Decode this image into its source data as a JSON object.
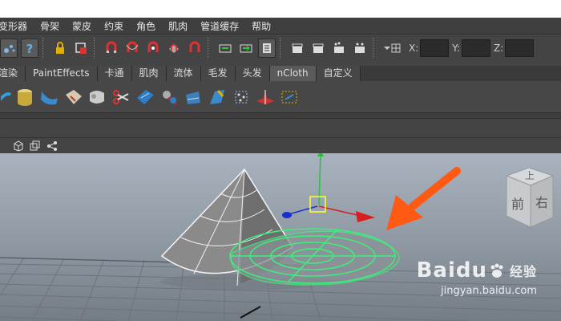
{
  "menu": {
    "items": [
      "变形器",
      "骨架",
      "蒙皮",
      "约束",
      "角色",
      "肌肉",
      "管道缓存",
      "帮助"
    ]
  },
  "status_line": {
    "x_label": "X:",
    "y_label": "Y:",
    "z_label": "Z:",
    "x_value": "",
    "y_value": "",
    "z_value": ""
  },
  "shelf": {
    "tabs": [
      "渲染",
      "PaintEffects",
      "卡通",
      "肌肉",
      "流体",
      "毛发",
      "头发",
      "nCloth",
      "自定义"
    ],
    "active_tab": "nCloth"
  },
  "view_cube": {
    "face_front": "前",
    "face_right": "右",
    "face_top": "上"
  },
  "watermark": {
    "brand": "Baidu",
    "brand_sub": "经验",
    "url": "jingyan.baidu.com"
  },
  "colors": {
    "arrow": "#ff5a14",
    "selection_green": "#3cf07a",
    "gizmo_y": "#1fc63c",
    "gizmo_x": "#d81e1e",
    "gizmo_z": "#1a2fd0",
    "gizmo_center": "#ffff33"
  }
}
